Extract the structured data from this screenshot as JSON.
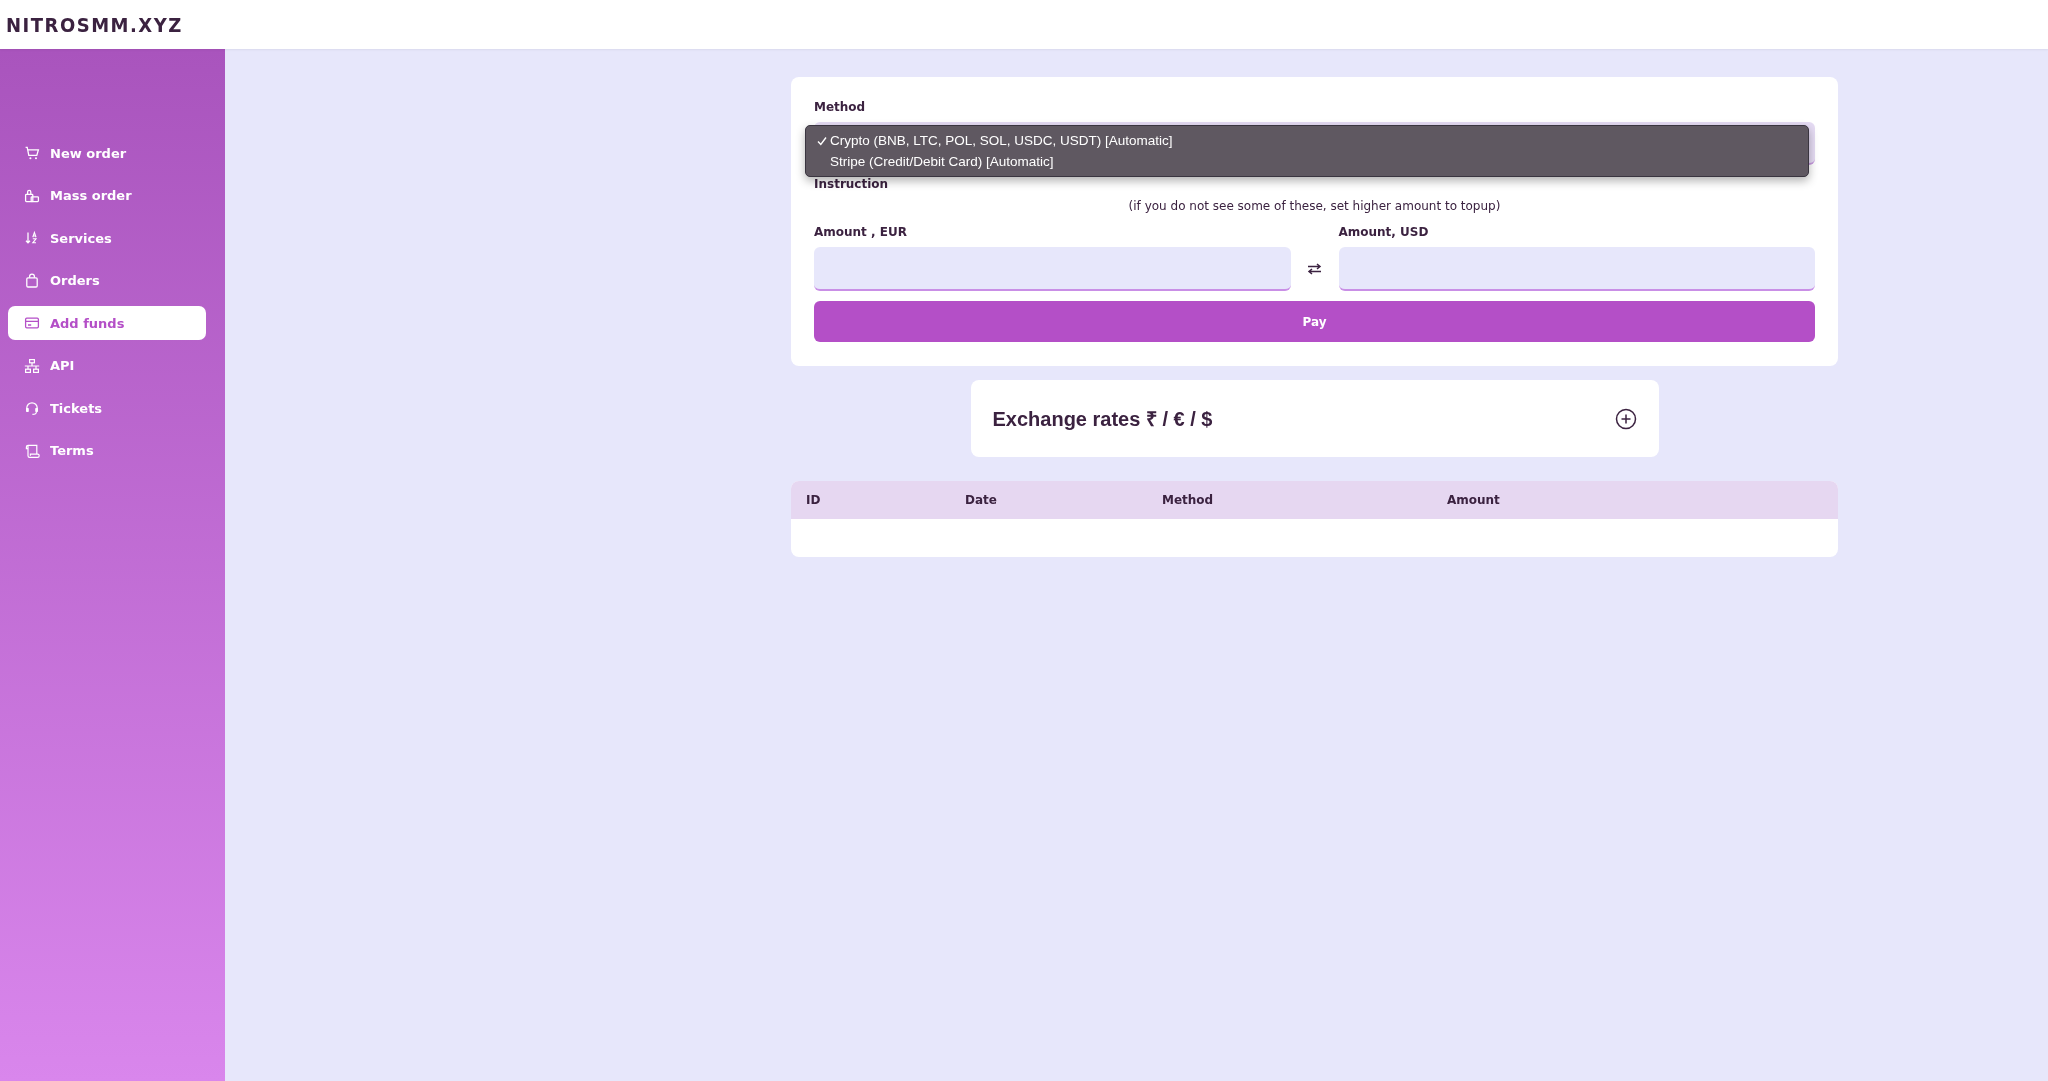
{
  "brand": "NITROSMM.XYZ",
  "sidebar": {
    "items": [
      {
        "label": "New order",
        "selected": false
      },
      {
        "label": "Mass order",
        "selected": false
      },
      {
        "label": "Services",
        "selected": false
      },
      {
        "label": "Orders",
        "selected": false
      },
      {
        "label": "Add funds",
        "selected": true
      },
      {
        "label": "API",
        "selected": false
      },
      {
        "label": "Tickets",
        "selected": false
      },
      {
        "label": "Terms",
        "selected": false
      }
    ]
  },
  "payment_form": {
    "method": {
      "label": "Method",
      "expanded": true,
      "options": [
        {
          "label": "Crypto (BNB, LTC, POL, SOL, USDC, USDT) [Automatic]",
          "selected": true
        },
        {
          "label": "Stripe (Credit/Debit Card) [Automatic]",
          "selected": false
        }
      ]
    },
    "instruction": {
      "label": "Instruction",
      "note": "(if you do not see some of these, set higher amount to topup)"
    },
    "amount_eur": {
      "label": "Amount , EUR"
    },
    "amount_usd": {
      "label": "Amount, USD"
    },
    "pay_button": "Pay"
  },
  "exchange_rates": {
    "title": "Exchange rates ₹ / € / $",
    "expanded": false
  },
  "history_table": {
    "columns": [
      "ID",
      "Date",
      "Method",
      "Amount"
    ]
  }
}
